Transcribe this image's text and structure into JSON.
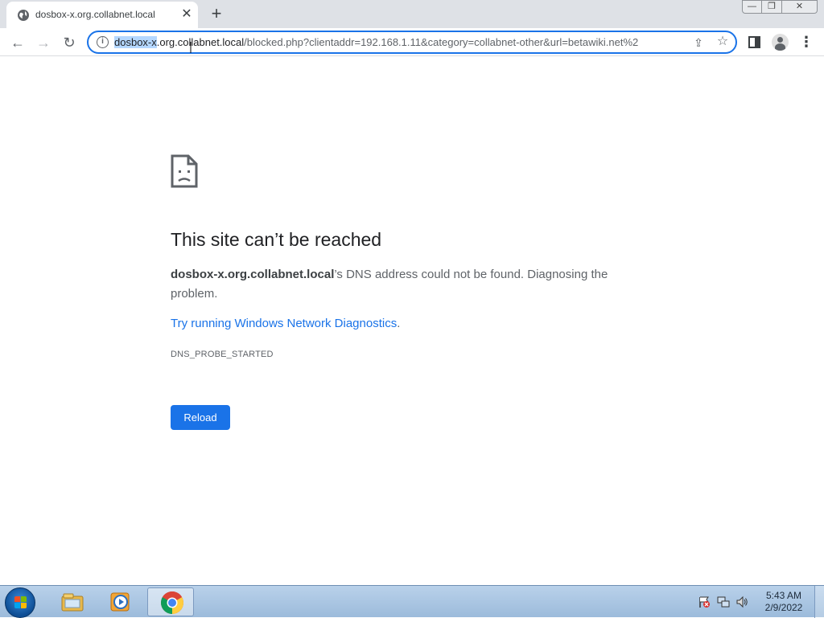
{
  "tab": {
    "title": "dosbox-x.org.collabnet.local",
    "favicon": "globe-icon",
    "close_icon": "close-icon"
  },
  "window_controls": {
    "minimize": "—",
    "maximize": "❐",
    "close": "✕"
  },
  "toolbar": {
    "back_icon": "←",
    "forward_icon": "→",
    "reload_icon": "↻",
    "new_tab_icon": "+",
    "menu_icon": "⋮"
  },
  "omnibox": {
    "url_selected": "dosbox-x",
    "url_host_rest": ".org.collabnet.local",
    "url_path": "/blocked.php?clientaddr=192.168.1.11&category=collabnet-other&url=betawiki.net%2",
    "info_icon": "i",
    "share_icon": "⇪",
    "star_icon": "☆"
  },
  "error": {
    "title": "This site can’t be reached",
    "host": "dosbox-x.org.collabnet.local",
    "description": "’s DNS address could not be found. Diagnosing the problem.",
    "link_text": "Try running Windows Network Diagnostics",
    "link_suffix": ".",
    "code": "DNS_PROBE_STARTED",
    "reload_label": "Reload"
  },
  "taskbar": {
    "time": "5:43 AM",
    "date": "2/9/2022",
    "items": [
      "file-explorer-icon",
      "media-player-icon",
      "chrome-icon"
    ]
  },
  "colors": {
    "accent": "#1a73e8",
    "taskbar": "#b9d1ea"
  }
}
